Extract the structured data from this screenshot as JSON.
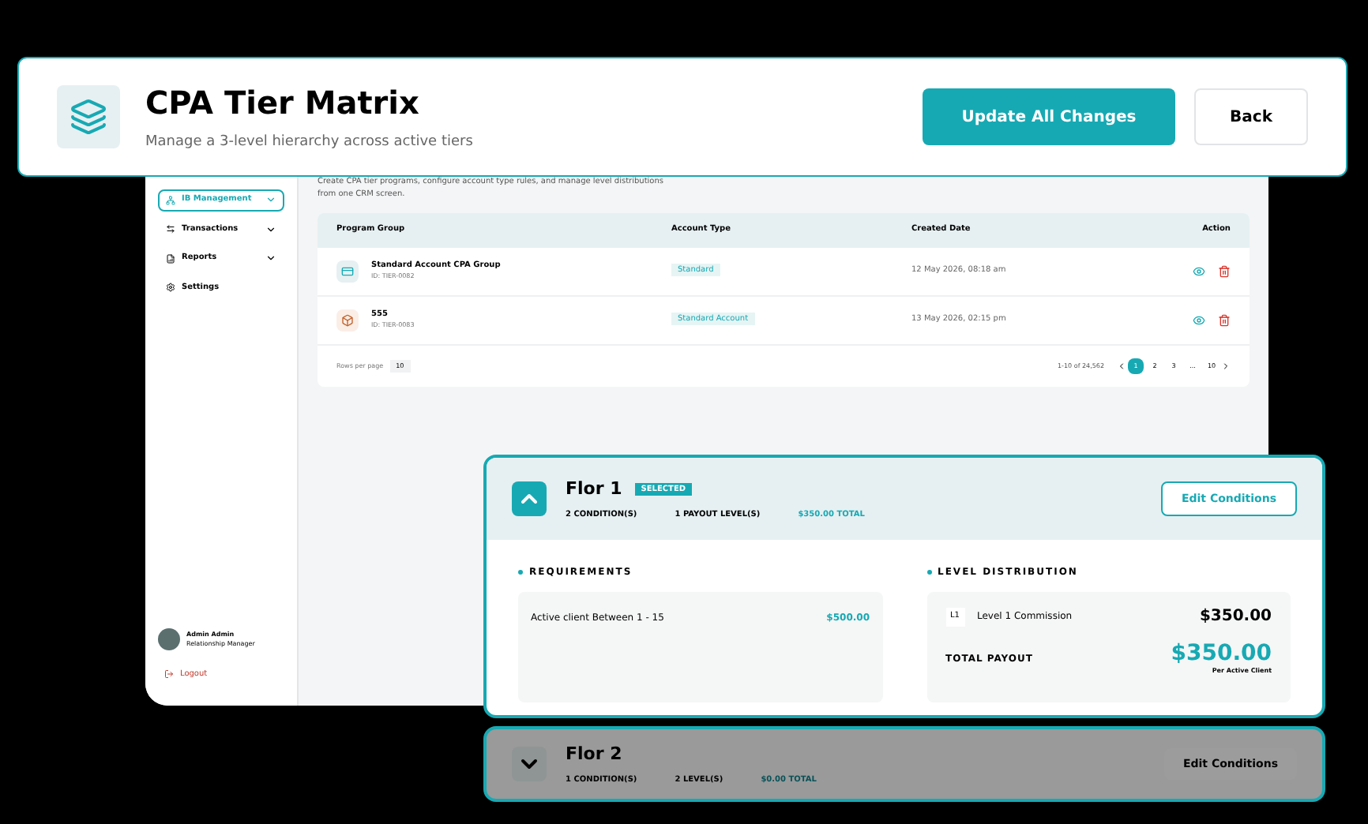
{
  "header": {
    "title": "CPA Tier Matrix",
    "subtitle": "Manage a 3-level hierarchy across active tiers",
    "buttons": [
      {
        "label": "Update All Changes",
        "kind": "primary"
      },
      {
        "label": "Back",
        "kind": "secondary"
      }
    ]
  },
  "dashboard": {
    "intro": [
      "Create CPA tier programs, configure account type rules, and manage level distributions",
      "from one CRM screen."
    ],
    "sidebar": {
      "items": [
        {
          "label": "IB Management",
          "kind": "network",
          "selected": true,
          "expandable": true
        },
        {
          "label": "Transactions",
          "kind": "arrows",
          "selected": false,
          "expandable": true
        },
        {
          "label": "Reports",
          "kind": "report",
          "selected": false,
          "expandable": true
        },
        {
          "label": "Settings",
          "kind": "gear",
          "selected": false,
          "expandable": false
        }
      ],
      "user": {
        "name": "Admin Admin",
        "role": "Relationship Manager"
      },
      "logout": "Logout"
    },
    "table": {
      "columns": [
        "Program Group",
        "Account Type",
        "Created Date",
        "Action"
      ],
      "rows": [
        {
          "name": "Standard Account CPA Group",
          "id": "ID: TIER-0082",
          "kind": "card",
          "account_type": "Standard",
          "created": "12 May 2026, 08:18 am"
        },
        {
          "name": "555",
          "id": "ID: TIER-0083",
          "kind": "box",
          "account_type": "Standard Account",
          "created": "13 May 2026, 02:15 pm"
        }
      ],
      "rows_per_page_label": "Rows per page",
      "rows_per_page": "10",
      "range": "1-10 of 24,562",
      "pages": [
        {
          "label": "1",
          "selected": true
        },
        {
          "label": "2",
          "selected": false
        },
        {
          "label": "3",
          "selected": false
        },
        {
          "label": "...",
          "selected": false
        },
        {
          "label": "10",
          "selected": false
        }
      ]
    }
  },
  "tiers": [
    {
      "name": "Flor 1",
      "badge": "SELECTED",
      "selected": true,
      "expanded": true,
      "conditions": "2 CONDITION(S)",
      "levels": "1 PAYOUT LEVEL(S)",
      "total": "$350.00 TOTAL",
      "edit": "Edit Conditions",
      "requirements_title": "REQUIREMENTS",
      "requirements": [
        {
          "label": "Active client Between 1 - 15",
          "amount": "$500.00"
        }
      ],
      "distribution_title": "LEVEL DISTRIBUTION",
      "level_rows": [
        {
          "code": "L1",
          "label": "Level 1 Commission",
          "amount": "$350.00"
        }
      ],
      "total_label": "TOTAL PAYOUT",
      "total_amount": "$350.00",
      "total_note": "Per Active Client"
    },
    {
      "name": "Flor 2",
      "selected": false,
      "expanded": false,
      "conditions": "1 CONDITION(S)",
      "levels": "2 LEVEL(S)",
      "total": "$0.00 TOTAL",
      "edit": "Edit Conditions"
    }
  ]
}
